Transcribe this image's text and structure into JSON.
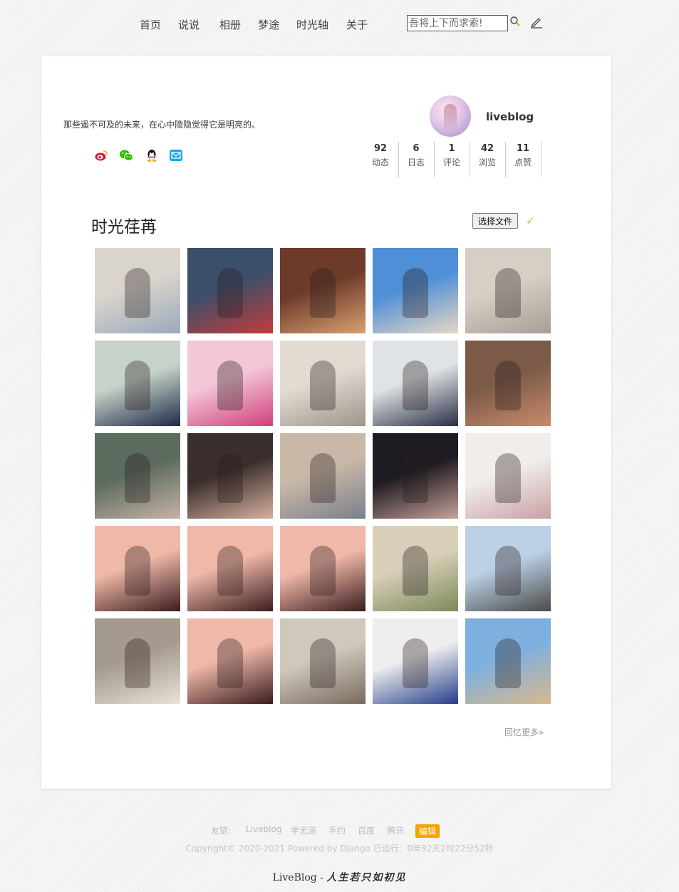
{
  "nav": {
    "items": [
      {
        "label": "首页"
      },
      {
        "label": "说说"
      },
      {
        "label": "相册"
      },
      {
        "label": "梦途"
      },
      {
        "label": "时光轴"
      },
      {
        "label": "关于"
      }
    ],
    "search": {
      "placeholder": "吾将上下而求索!"
    },
    "icons": {
      "search": "search-icon",
      "edit": "pencil-icon"
    }
  },
  "profile": {
    "motto": "那些遥不可及的未来，在心中隐隐觉得它是明亮的。",
    "social_icons": [
      "weibo-icon",
      "wechat-icon",
      "qq-icon",
      "mail-icon"
    ],
    "username": "liveblog",
    "stats": [
      {
        "value": "92",
        "label": "动态"
      },
      {
        "value": "6",
        "label": "日志"
      },
      {
        "value": "1",
        "label": "评论"
      },
      {
        "value": "42",
        "label": "浏览"
      },
      {
        "value": "11",
        "label": "点赞"
      }
    ]
  },
  "album": {
    "title": "时光荏苒",
    "file_button": "选择文件",
    "check_mark": "✓",
    "more_link": "回忆更多»",
    "photos": [
      {
        "name": "girl-sitting-beach",
        "c1": "#d9d4cc",
        "c2": "#9aa9bd"
      },
      {
        "name": "girl-cafe-red-chairs",
        "c1": "#3b4f6b",
        "c2": "#c33b3b"
      },
      {
        "name": "girl-fastfood-counter",
        "c1": "#6e3b2a",
        "c2": "#d8a070"
      },
      {
        "name": "girl-standing-beach",
        "c1": "#4f8fd8",
        "c2": "#e7d8c2"
      },
      {
        "name": "girl-sitting-sand",
        "c1": "#d6cfc5",
        "c2": "#a89f94"
      },
      {
        "name": "girl-navy-hoodie",
        "c1": "#c7d3c9",
        "c2": "#1e2a45"
      },
      {
        "name": "girl-pink-cap-collage",
        "c1": "#f3c6d8",
        "c2": "#d0407a"
      },
      {
        "name": "girl-beach-sitting-2",
        "c1": "#e1dbd2",
        "c2": "#9e958c"
      },
      {
        "name": "girl-mickey-ears",
        "c1": "#dfe3e6",
        "c2": "#2a2f45"
      },
      {
        "name": "girl-long-hair-selfie",
        "c1": "#7b5a48",
        "c2": "#c98a6d"
      },
      {
        "name": "girl-green-cap",
        "c1": "#5b6b5e",
        "c2": "#c7b2a6"
      },
      {
        "name": "girl-close-selfie",
        "c1": "#3a2e2c",
        "c2": "#d8b0a0"
      },
      {
        "name": "girl-sweater-selfie",
        "c1": "#c9b8a8",
        "c2": "#7b7f8c"
      },
      {
        "name": "girl-profile-dark-hair",
        "c1": "#1f1b22",
        "c2": "#c7a29a"
      },
      {
        "name": "girl-cartoon-bear",
        "c1": "#f1eeea",
        "c2": "#c9a0a4"
      },
      {
        "name": "kiss-me-selfie-1",
        "c1": "#f0b8a8",
        "c2": "#3a1c1e"
      },
      {
        "name": "kiss-me-selfie-2",
        "c1": "#f0b8a8",
        "c2": "#3a1c1e"
      },
      {
        "name": "kiss-me-selfie-3",
        "c1": "#f0b8a8",
        "c2": "#3a1c1e"
      },
      {
        "name": "girl-kitchen",
        "c1": "#d8cfb8",
        "c2": "#7c8a5a"
      },
      {
        "name": "girl-outdoor-pose",
        "c1": "#bcd0e6",
        "c2": "#4a4a4a"
      },
      {
        "name": "girl-window-light",
        "c1": "#a59a8e",
        "c2": "#e9e2d6"
      },
      {
        "name": "kiss-me-selfie-4",
        "c1": "#f0b8a8",
        "c2": "#3a1c1e"
      },
      {
        "name": "girl-beach-photo-frames",
        "c1": "#cfc8bd",
        "c2": "#7a6a5e"
      },
      {
        "name": "girl-brick-wall",
        "c1": "#eeeeee",
        "c2": "#263e8a"
      },
      {
        "name": "girl-seaside-rocks",
        "c1": "#7db0df",
        "c2": "#d9b88e"
      }
    ]
  },
  "footer": {
    "friends_label": "友链:",
    "links": [
      "Liveblog",
      "学无涯",
      "手约",
      "百度",
      "腾讯"
    ],
    "edit_badge": "编辑",
    "copyright": "Copyright© 2020-2021   Powered by Django   已运行：0年92天2时22分52秒",
    "signature_prefix": "LiveBlog - ",
    "signature_script": "人生若只如初见"
  }
}
